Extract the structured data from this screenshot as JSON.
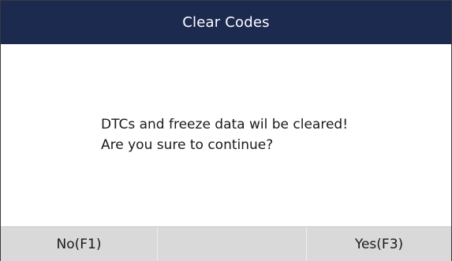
{
  "title": "Clear Codes",
  "message": {
    "line1": "DTCs and freeze data wil be cleared!",
    "line2": "Are you sure to continue?"
  },
  "function_keys": {
    "f1_label": "No(F1)",
    "f2_label": "",
    "f3_label": "Yes(F3)"
  },
  "colors": {
    "title_bar": "#1c2a4f",
    "function_bar": "#d9d9d9"
  }
}
